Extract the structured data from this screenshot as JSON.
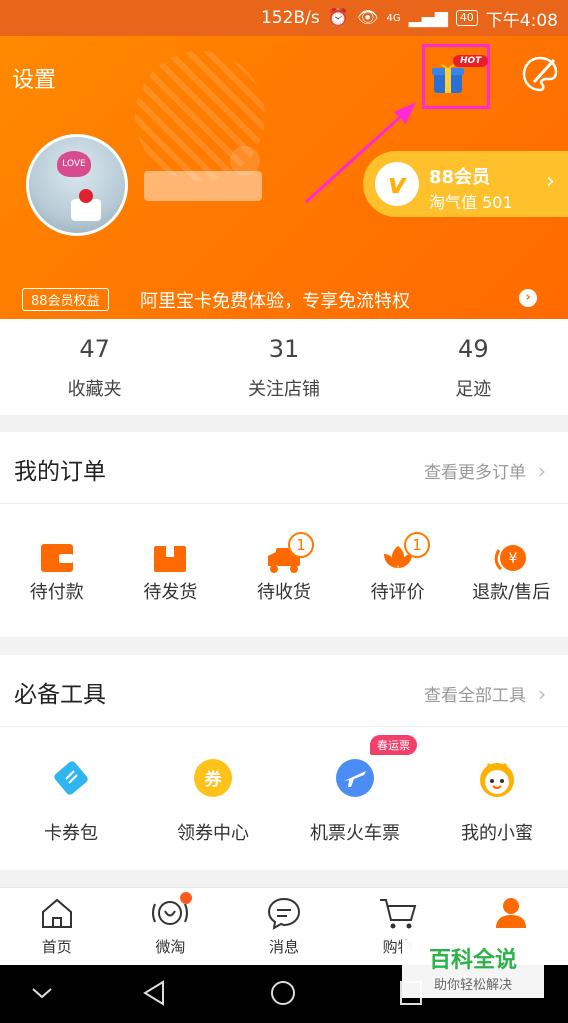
{
  "status_bar": {
    "speed": "152B/s",
    "network": "4G",
    "battery": "40",
    "time": "下午4:08"
  },
  "header": {
    "settings": "设置",
    "hot_badge": "HOT",
    "vip": {
      "icon_letter": "v",
      "title": "88会员",
      "points": "淘气值 501"
    },
    "benefit_tag": "88会员权益",
    "benefit_text": "阿里宝卡免费体验，专享免流特权"
  },
  "stats": [
    {
      "value": "47",
      "label": "收藏夹"
    },
    {
      "value": "31",
      "label": "关注店铺"
    },
    {
      "value": "49",
      "label": "足迹"
    }
  ],
  "orders": {
    "title": "我的订单",
    "more": "查看更多订单",
    "items": [
      {
        "label": "待付款",
        "icon": "wallet-icon"
      },
      {
        "label": "待发货",
        "icon": "package-icon"
      },
      {
        "label": "待收货",
        "icon": "truck-icon",
        "badge": "1"
      },
      {
        "label": "待评价",
        "icon": "flower-icon",
        "badge": "1"
      },
      {
        "label": "退款/售后",
        "icon": "refund-icon"
      }
    ]
  },
  "tools": {
    "title": "必备工具",
    "more": "查看全部工具",
    "items": [
      {
        "label": "卡券包",
        "icon": "ticket-icon"
      },
      {
        "label": "领券中心",
        "icon": "coupon-icon",
        "icon_text": "券"
      },
      {
        "label": "机票火车票",
        "icon": "plane-icon",
        "badge": "春运票"
      },
      {
        "label": "我的小蜜",
        "icon": "assistant-icon"
      }
    ]
  },
  "tabbar": [
    {
      "label": "首页",
      "icon": "home-icon"
    },
    {
      "label": "微淘",
      "icon": "weitao-icon"
    },
    {
      "label": "消息",
      "icon": "message-icon"
    },
    {
      "label": "购物",
      "icon": "cart-icon"
    },
    {
      "label": "",
      "icon": "profile-icon"
    }
  ],
  "watermark": {
    "title": "百科全说",
    "sub": "助你轻松解决"
  },
  "colors": {
    "primary": "#ff7a00",
    "vip": "#ffc12b",
    "highlight": "#ff2ad4"
  }
}
